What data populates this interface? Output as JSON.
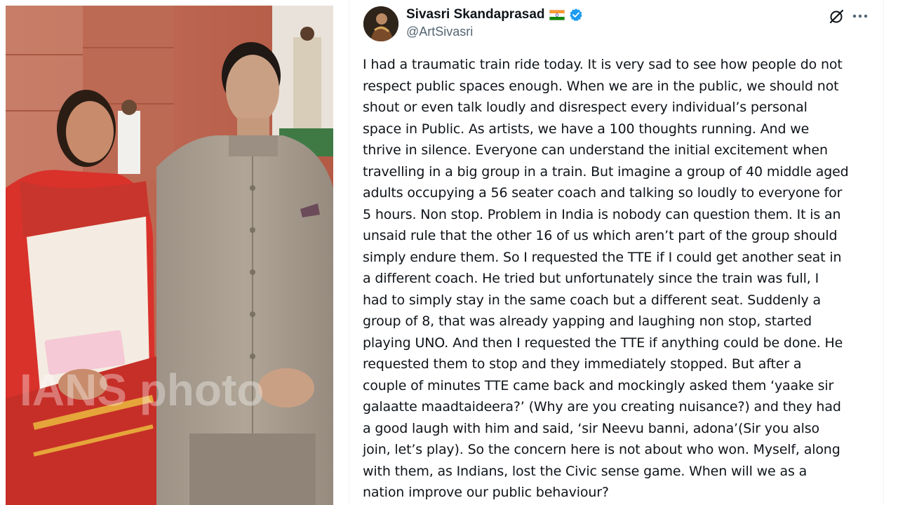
{
  "photo": {
    "description_icon": "photo-image",
    "watermark_text": "IANS photo"
  },
  "tweet": {
    "author": {
      "display_name": "Sivasri Skandaprasad",
      "handle": "@ArtSivasri",
      "flag_icon": "india-flag-icon",
      "verified_icon": "verified-badge-icon"
    },
    "actions": {
      "grok_icon": "grok-icon",
      "more_icon": "more-icon"
    },
    "text_lines": [
      "I had a traumatic train ride today. It is very sad to see how people do not",
      "respect public spaces enough. When we are in the public, we should not",
      "shout or even talk loudly and disrespect every individual’s personal",
      "space in Public. As artists, we have a 100 thoughts running. And we",
      "thrive in silence. Everyone can understand the initial excitement when",
      "travelling in a big group in a train. But imagine a group of 40 middle aged",
      "adults occupying a 56 seater coach and talking so loudly to everyone for",
      "5 hours. Non stop. Problem in India is nobody can question them. It is an",
      "unsaid rule that the other 16 of us which aren’t part of the group should",
      "simply endure them. So I requested the TTE if I could get another seat in",
      "a different coach. He tried but unfortunately since the train was full, I",
      "had to simply stay in the same coach but a different seat. Suddenly a",
      "group of 8, that was already yapping and laughing non stop, started",
      "playing UNO. And then I requested the TTE if anything could be done. He",
      "requested them to stop and they immediately stopped. But after a",
      "couple of minutes TTE came back and mockingly asked them ‘yaake sir",
      "galaatte maadtaideera?’ (Why are you creating nuisance?) and they had",
      "a good laugh with him and said, ‘sir Neevu banni, adona’(Sir you also",
      "join, let’s play). So the concern here is not about who won. Myself, along",
      "with them, as Indians, lost the Civic sense game. When will we as a",
      "nation improve our public behaviour?"
    ]
  },
  "colors": {
    "text_primary": "#0f1419",
    "text_secondary": "#536471",
    "verified_blue": "#1d9bf0",
    "saree_red": "#d9322b",
    "suit_grey": "#a69a8c",
    "wall_red": "#b8644f"
  }
}
